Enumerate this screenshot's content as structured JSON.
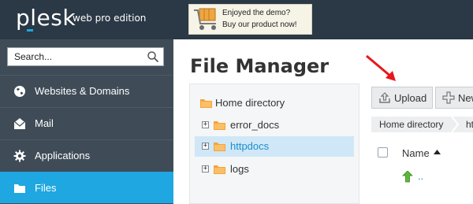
{
  "header": {
    "logo": "plesk",
    "edition": "web pro edition",
    "promo": {
      "line1": "Enjoyed the demo?",
      "line2": "Buy our product now!",
      "icon": "shopping-cart-icon"
    }
  },
  "sidebar": {
    "search": {
      "placeholder": "Search...",
      "value": "",
      "icon": "search-icon"
    },
    "items": [
      {
        "label": "Websites & Domains",
        "icon": "globe-icon",
        "active": false
      },
      {
        "label": "Mail",
        "icon": "mail-icon",
        "active": false
      },
      {
        "label": "Applications",
        "icon": "gear-icon",
        "active": false
      },
      {
        "label": "Files",
        "icon": "folder-icon",
        "active": true
      }
    ]
  },
  "main": {
    "title": "File Manager",
    "tree": [
      {
        "label": "Home directory",
        "expandable": false,
        "selected": false
      },
      {
        "label": "error_docs",
        "expandable": true,
        "selected": false
      },
      {
        "label": "httpdocs",
        "expandable": true,
        "selected": true
      },
      {
        "label": "logs",
        "expandable": true,
        "selected": false
      }
    ],
    "toolbar": {
      "upload": "Upload",
      "new": "New"
    },
    "breadcrumb": [
      "Home directory",
      "httpdocs"
    ],
    "columns": {
      "name": "Name"
    },
    "rows": [
      {
        "name": "..",
        "icon": "up-arrow-icon"
      }
    ]
  },
  "colors": {
    "topbar": "#2b3845",
    "sidebar": "#3f4c57",
    "accent": "#1ea7e0",
    "annotation_arrow": "#e8161a"
  }
}
